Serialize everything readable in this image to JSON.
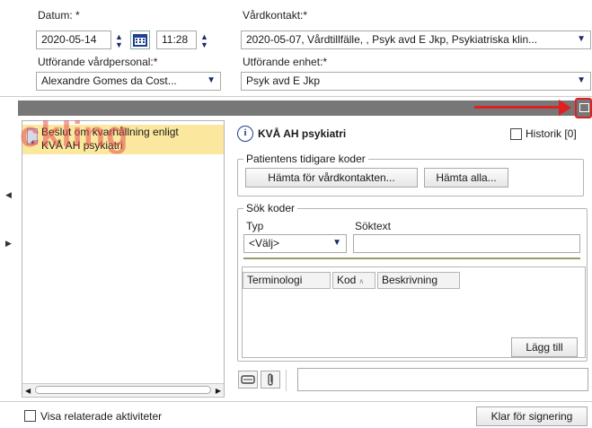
{
  "form": {
    "date_label": "Datum: *",
    "date_value": "2020-05-14",
    "time_value": "11:28",
    "contact_label": "Vårdkontakt:*",
    "contact_value": "2020-05-07, Vårdtillfälle, , Psyk avd E Jkp, Psykiatriska klin...",
    "staff_label": "Utförande vårdpersonal:*",
    "staff_value": "Alexandre Gomes da Cost...",
    "unit_label": "Utförande enhet:*",
    "unit_value": "Psyk avd E Jkp"
  },
  "watermark": "ckling",
  "list": {
    "item_line1": "Beslut om kvarhållning enligt",
    "item_line2": "KVÅ AH psykiatri",
    "item_marker": "*"
  },
  "panel": {
    "title": "KVÅ AH psykiatri",
    "history_label": "Historik [0]",
    "prev_codes_title": "Patientens tidigare koder",
    "fetch_contact_btn": "Hämta för vårdkontakten...",
    "fetch_all_btn": "Hämta alla...",
    "search_title": "Sök koder",
    "type_label": "Typ",
    "type_value": "<Välj>",
    "search_text_label": "Söktext",
    "search_text_value": "",
    "columns": [
      "Terminologi",
      "Kod",
      "Beskrivning"
    ],
    "add_btn": "Lägg till"
  },
  "footer": {
    "related_label": "Visa relaterade aktiviteter",
    "sign_btn": "Klar för signering"
  },
  "colors": {
    "accent_red": "#e02020",
    "selected_row": "#fbe89e",
    "toolbar": "#777777"
  }
}
